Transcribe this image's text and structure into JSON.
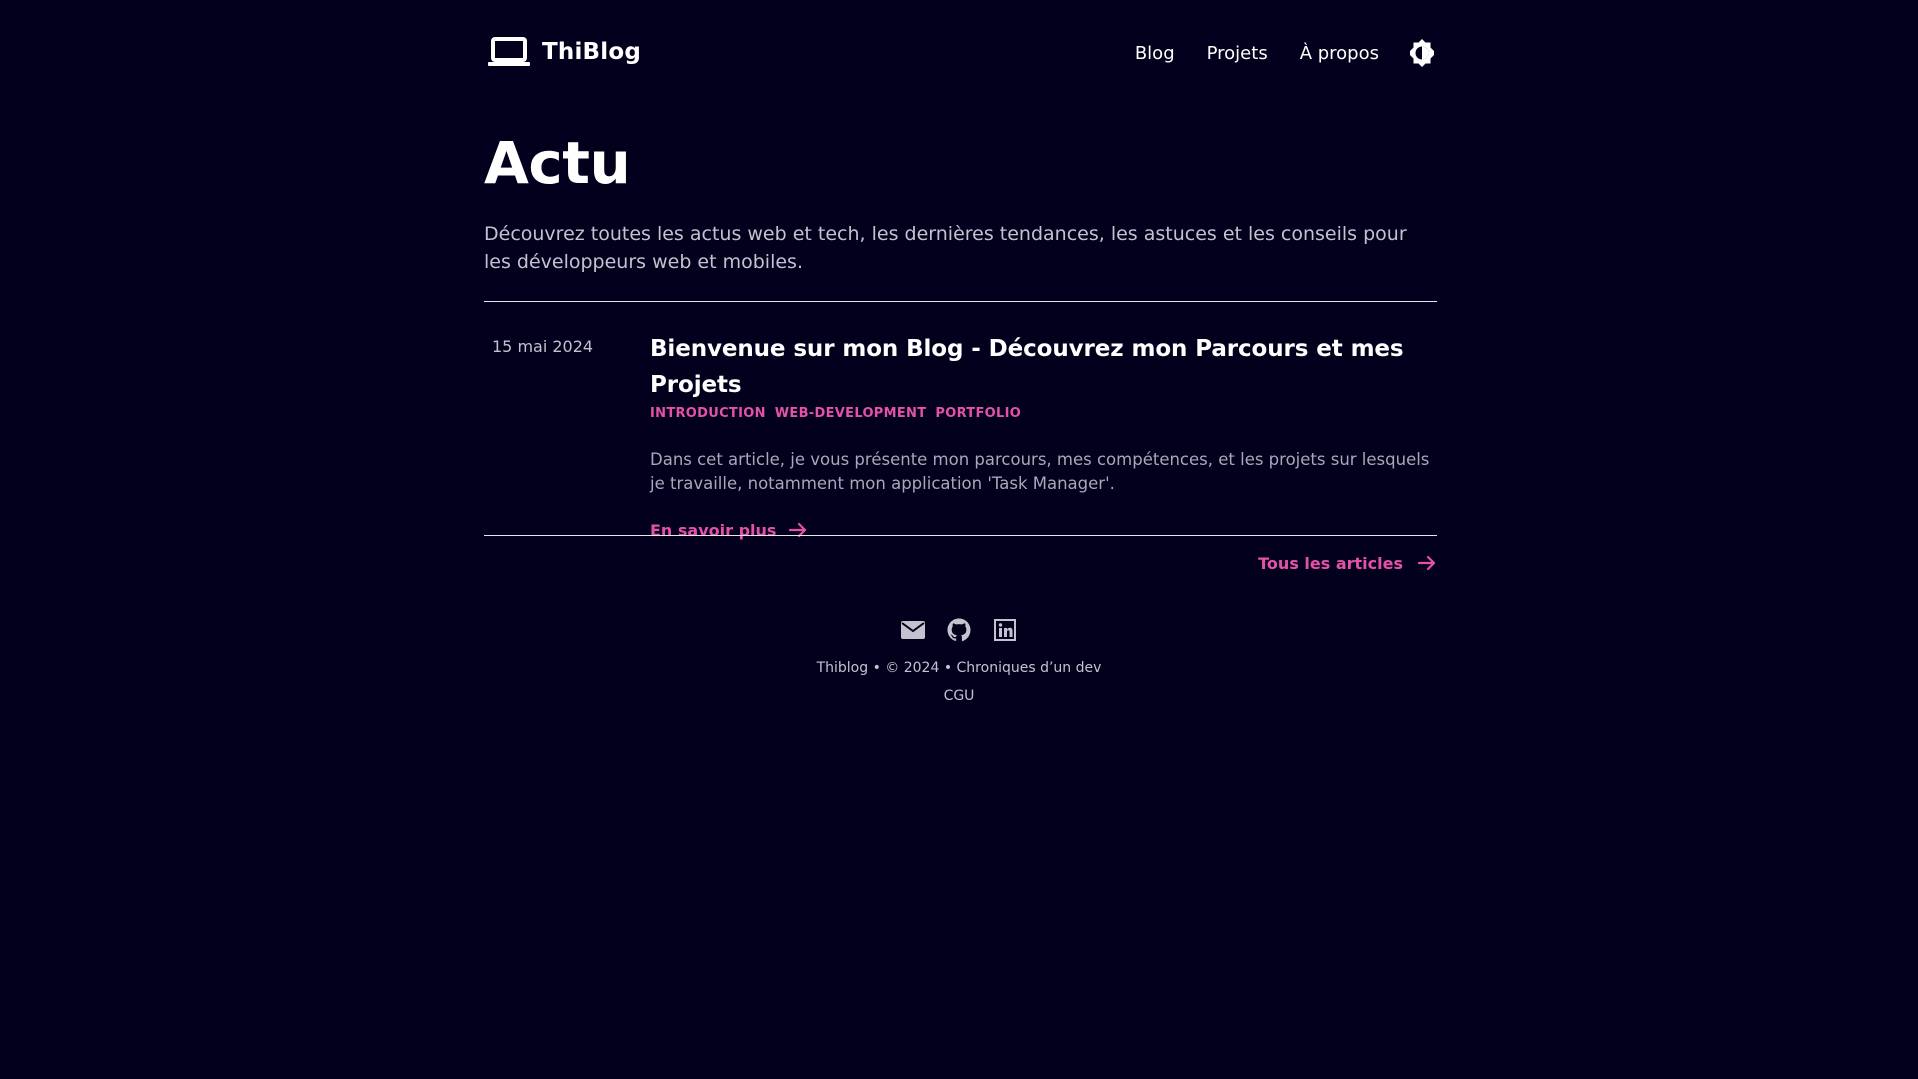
{
  "header": {
    "brand_name": "ThiBlog",
    "nav": [
      "Blog",
      "Projets",
      "À propos"
    ]
  },
  "hero": {
    "title": "Actu",
    "intro": "Découvrez toutes les actus web et tech, les dernières tendances, les astuces et les conseils pour les développeurs web et mobiles."
  },
  "articles": [
    {
      "date": "15 mai 2024",
      "title": "Bienvenue sur mon Blog - Découvrez mon Parcours et mes Projets",
      "tags": [
        "INTRODUCTION",
        "WEB-DEVELOPMENT",
        "PORTFOLIO"
      ],
      "summary": "Dans cet article, je vous présente mon parcours, mes compétences, et les projets sur lesquels je travaille, notamment mon application 'Task Manager'.",
      "read_more": "En savoir plus"
    }
  ],
  "all_articles_label": "Tous les articles",
  "footer": {
    "socials": [
      "mail-icon",
      "github-icon",
      "linkedin-icon"
    ],
    "line": "Thiblog • © 2024 • Chroniques d’un dev",
    "cgu": "CGU"
  },
  "colors": {
    "background": "#02001c",
    "accent": "#e452a8",
    "text": "#ffffff",
    "muted": "#c4c2cf"
  }
}
